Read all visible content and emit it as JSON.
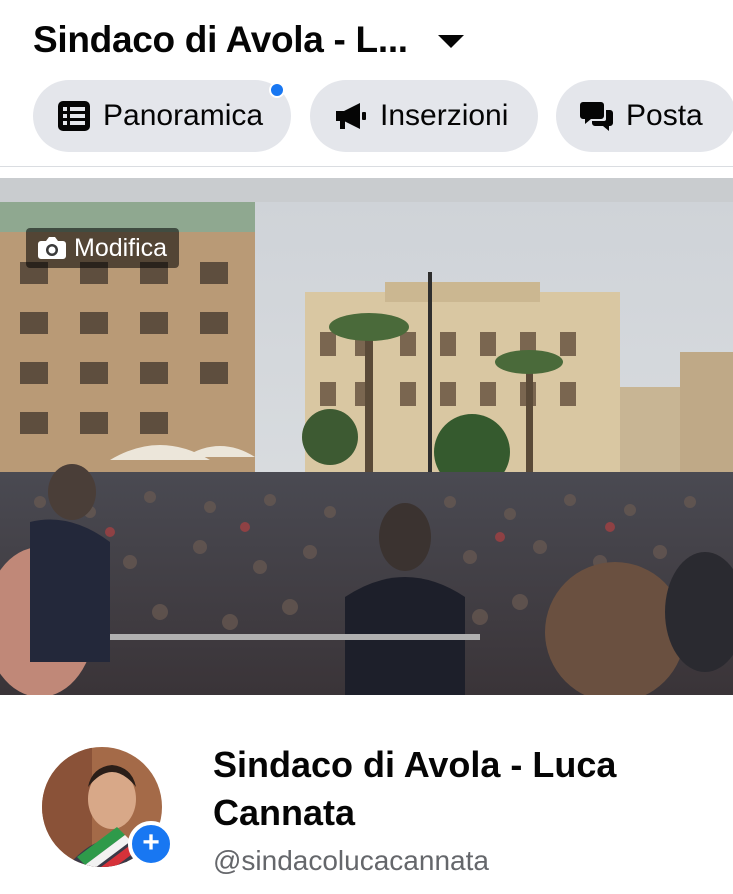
{
  "header": {
    "page_title": "Sindaco di Avola - L...",
    "switch_icon": "caret-down-icon"
  },
  "tabs": [
    {
      "label": "Panoramica",
      "icon": "list-icon",
      "has_notification": true
    },
    {
      "label": "Inserzioni",
      "icon": "megaphone-icon"
    },
    {
      "label": "Posta",
      "icon": "chat-bubbles-icon"
    }
  ],
  "cover": {
    "edit_label": "Modifica",
    "edit_icon": "camera-icon"
  },
  "profile": {
    "name": "Sindaco di Avola - Luca Cannata",
    "handle": "@sindacolucacannata",
    "add_icon": "plus-icon"
  },
  "colors": {
    "accent": "#1877f2",
    "tab_bg": "#e4e6eb",
    "text": "#050505",
    "secondary_text": "#65676b"
  }
}
